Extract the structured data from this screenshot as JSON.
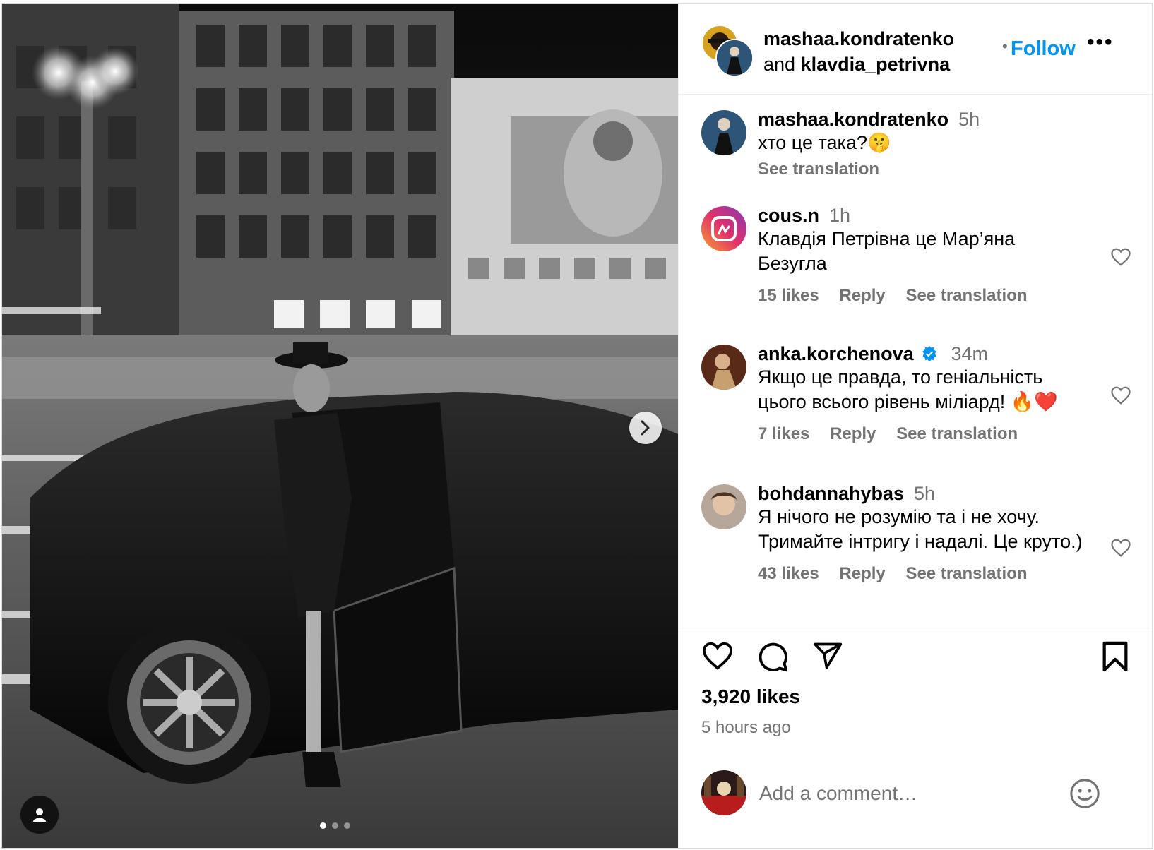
{
  "header": {
    "author": "mashaa.kondratenko",
    "and_word": "and",
    "coauthor": "klavdia_petrivna",
    "follow_label": "Follow",
    "follow_sep": "•",
    "more_label": "•••"
  },
  "caption": {
    "user": "mashaa.kondratenko",
    "time": "5h",
    "text": "хто це така?🤫",
    "see_translation": "See translation"
  },
  "comments": [
    {
      "user": "cous.n",
      "time": "1h",
      "text": "Клавдія Петрівна це Мар’яна Безугла",
      "likes": "15 likes",
      "reply": "Reply",
      "see_translation": "See translation"
    },
    {
      "user": "anka.korchenova",
      "verified": true,
      "time": "34m",
      "text": "Якщо це правда, то геніальність цього всього рівень міліард! 🔥❤️",
      "likes": "7 likes",
      "reply": "Reply",
      "see_translation": "See translation"
    },
    {
      "user": "bohdannahybas",
      "time": "5h",
      "text": "Я нічого не розумію та і не хочу. Тримайте інтригу і надалі. Це круто.)",
      "likes": "43 likes",
      "reply": "Reply",
      "see_translation": "See translation"
    }
  ],
  "post": {
    "likes": "3,920 likes",
    "time_ago": "5 hours ago"
  },
  "composer": {
    "placeholder": "Add a comment…"
  },
  "media": {
    "carousel_count": 3,
    "carousel_active": 1
  },
  "colors": {
    "accent": "#0095f6",
    "muted": "#737373",
    "verified": "#0095f6"
  },
  "icons": [
    "heart-icon",
    "comment-icon",
    "share-icon",
    "bookmark-icon",
    "emoji-icon",
    "chevron-right-icon",
    "user-tag-icon",
    "verified-icon"
  ]
}
